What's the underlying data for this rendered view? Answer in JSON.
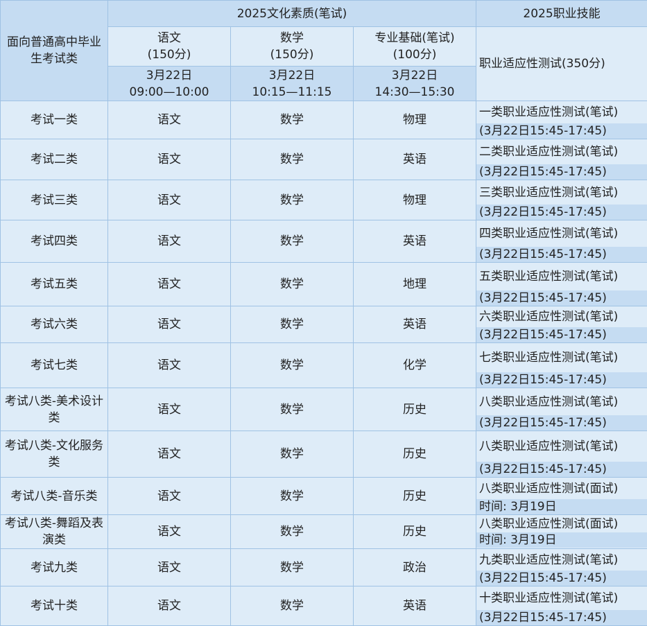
{
  "header": {
    "category_col": "面向普通高中毕业生考试类",
    "culture_group": "2025文化素质(笔试)",
    "skill_group": "2025职业技能",
    "chinese": {
      "name": "语文",
      "score": "(150分)",
      "date": "3月22日",
      "time": "09:00—10:00"
    },
    "math": {
      "name": "数学",
      "score": "(150分)",
      "date": "3月22日",
      "time": "10:15—11:15"
    },
    "basic": {
      "name": "专业基础(笔试)",
      "score": "(100分)",
      "date": "3月22日",
      "time": "14:30—15:30"
    },
    "aptitude": "职业适应性测试(350分)"
  },
  "rows": [
    {
      "category": "考试一类",
      "chinese": "语文",
      "math": "数学",
      "basic": "物理",
      "test": "一类职业适应性测试(笔试)",
      "time": "(3月22日15:45-17:45)"
    },
    {
      "category": "考试二类",
      "chinese": "语文",
      "math": "数学",
      "basic": "英语",
      "test": "二类职业适应性测试(笔试)",
      "time": "(3月22日15:45-17:45)"
    },
    {
      "category": "考试三类",
      "chinese": "语文",
      "math": "数学",
      "basic": "物理",
      "test": "三类职业适应性测试(笔试)",
      "time": "(3月22日15:45-17:45)"
    },
    {
      "category": "考试四类",
      "chinese": "语文",
      "math": "数学",
      "basic": "英语",
      "test": "四类职业适应性测试(笔试)",
      "time": "(3月22日15:45-17:45)"
    },
    {
      "category": "考试五类",
      "chinese": "语文",
      "math": "数学",
      "basic": "地理",
      "test": "五类职业适应性测试(笔试)",
      "time": "(3月22日15:45-17:45)"
    },
    {
      "category": "考试六类",
      "chinese": "语文",
      "math": "数学",
      "basic": "英语",
      "test": "六类职业适应性测试(笔试)",
      "time": "(3月22日15:45-17:45)"
    },
    {
      "category": "考试七类",
      "chinese": "语文",
      "math": "数学",
      "basic": "化学",
      "test": "七类职业适应性测试(笔试)",
      "time": "(3月22日15:45-17:45)"
    },
    {
      "category": "考试八类-美术设计类",
      "chinese": "语文",
      "math": "数学",
      "basic": "历史",
      "test": "八类职业适应性测试(笔试)",
      "time": "(3月22日15:45-17:45)"
    },
    {
      "category": "考试八类-文化服务类",
      "chinese": "语文",
      "math": "数学",
      "basic": "历史",
      "test": "八类职业适应性测试(笔试)",
      "time": "(3月22日15:45-17:45)"
    },
    {
      "category": "考试八类-音乐类",
      "chinese": "语文",
      "math": "数学",
      "basic": "历史",
      "test": "八类职业适应性测试(面试)",
      "time": "时间: 3月19日"
    },
    {
      "category": "考试八类-舞蹈及表演类",
      "chinese": "语文",
      "math": "数学",
      "basic": "历史",
      "test": "八类职业适应性测试(面试)",
      "time": "时间: 3月19日"
    },
    {
      "category": "考试九类",
      "chinese": "语文",
      "math": "数学",
      "basic": "政治",
      "test": "九类职业适应性测试(笔试)",
      "time": "(3月22日15:45-17:45)"
    },
    {
      "category": "考试十类",
      "chinese": "语文",
      "math": "数学",
      "basic": "英语",
      "test": "十类职业适应性测试(笔试)",
      "time": "(3月22日15:45-17:45)"
    }
  ]
}
